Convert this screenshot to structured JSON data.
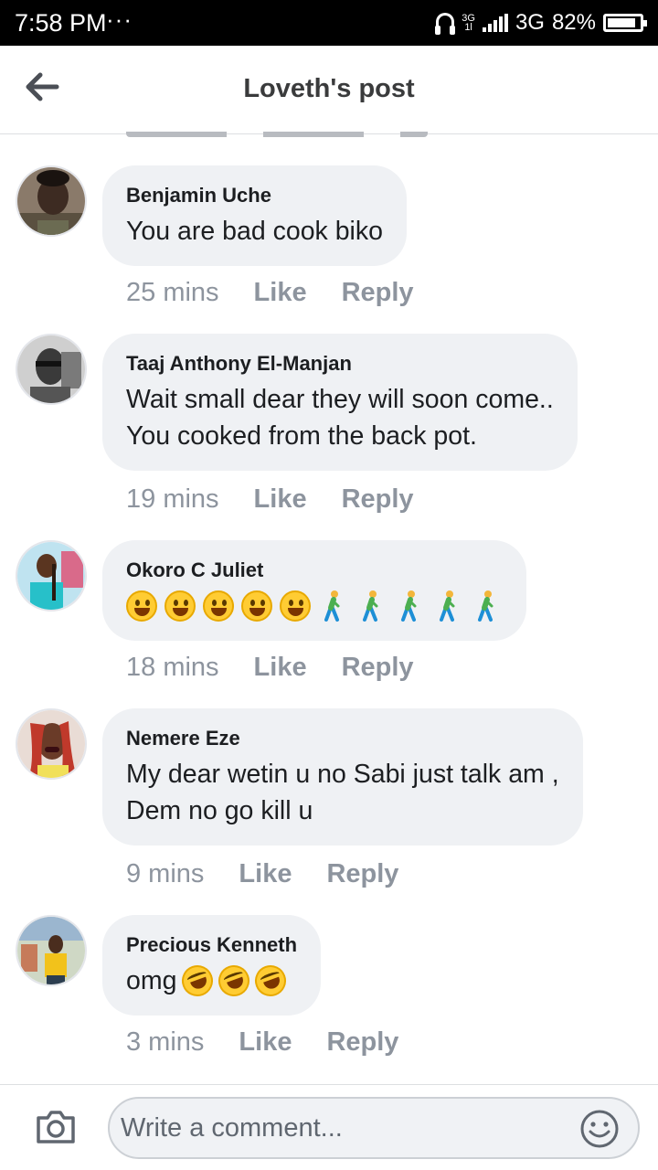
{
  "status_bar": {
    "time": "7:58 PM",
    "dots": "···",
    "network_small": "3G",
    "network_sub": "1l",
    "network": "3G",
    "battery_percent": "82%",
    "battery_level": 0.82
  },
  "header": {
    "title": "Loveth's post",
    "back_icon": "arrow-left-icon"
  },
  "comments": [
    {
      "author": "Benjamin Uche",
      "text_lines": [
        "You are bad cook biko"
      ],
      "time": "25 mins",
      "like": "Like",
      "reply": "Reply"
    },
    {
      "author": "Taaj Anthony El-Manjan",
      "text_lines": [
        "Wait small dear they will soon come..",
        "You cooked from the back pot."
      ],
      "time": "19 mins",
      "like": "Like",
      "reply": "Reply"
    },
    {
      "author": "Okoro C Juliet",
      "text_lines": [],
      "emoji": [
        "😀",
        "😀",
        "😀",
        "😀",
        "😀",
        "🚶",
        "🚶",
        "🚶",
        "🚶",
        "🚶"
      ],
      "time": "18 mins",
      "like": "Like",
      "reply": "Reply"
    },
    {
      "author": "Nemere Eze",
      "text_lines": [
        "My dear wetin u no Sabi just talk am ,",
        "Dem no go kill u"
      ],
      "time": "9 mins",
      "like": "Like",
      "reply": "Reply"
    },
    {
      "author": "Precious Kenneth",
      "text_lines": [
        "omg"
      ],
      "emoji": [
        "🤣",
        "🤣",
        "🤣"
      ],
      "time": "3 mins",
      "like": "Like",
      "reply": "Reply"
    }
  ],
  "composer": {
    "placeholder": "Write a comment...",
    "camera_icon": "camera-icon",
    "emoji_icon": "smiley-icon"
  },
  "colors": {
    "bubble": "#eff1f4",
    "meta_text": "#8d949e",
    "status_bar": "#000000"
  }
}
